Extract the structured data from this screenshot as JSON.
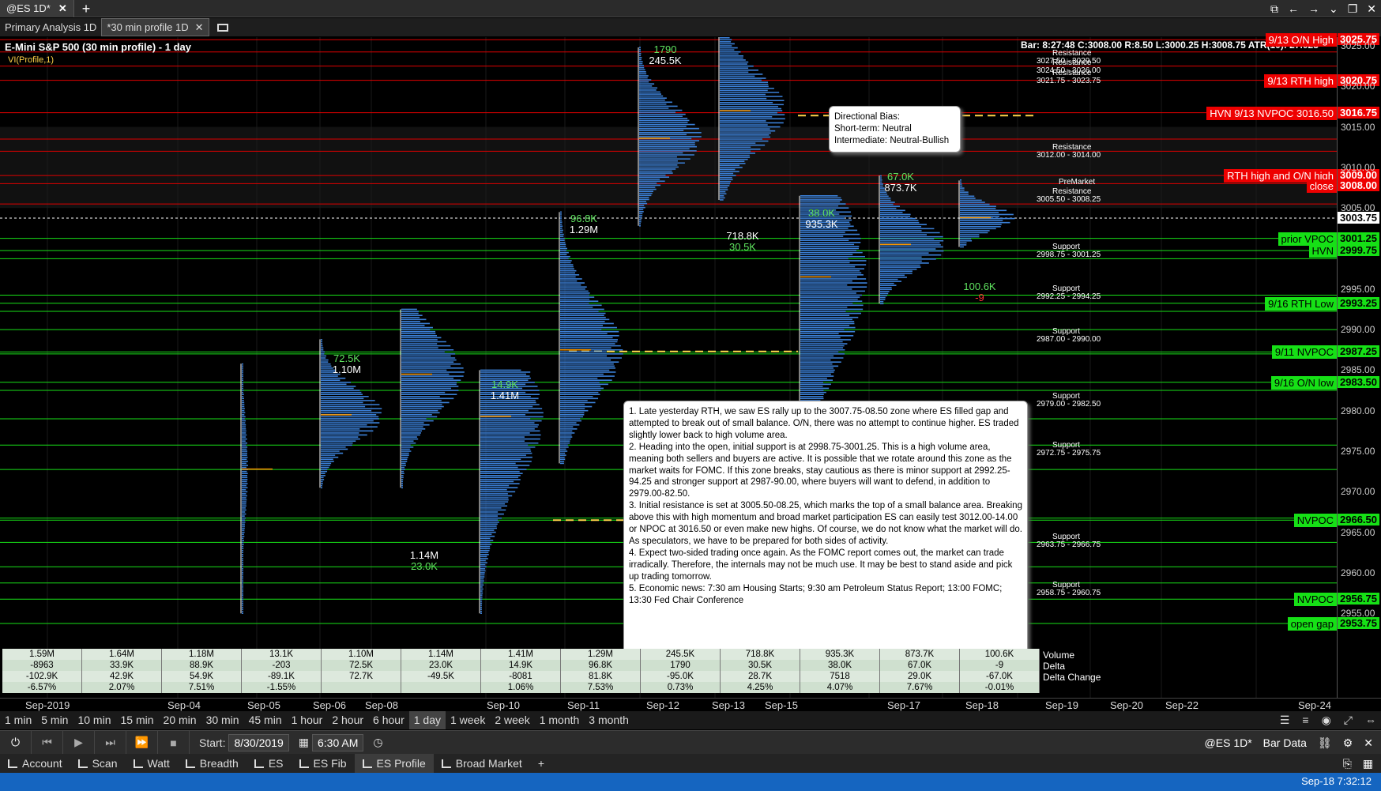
{
  "window": {
    "tabs": [
      {
        "label": "@ES 1D*"
      },
      {
        "label": "Primary Analysis 1D"
      },
      {
        "label": "*30 min profile 1D"
      }
    ]
  },
  "chart": {
    "title": "E-Mini S&P 500 (30 min profile) - 1 day",
    "study": "VI(Profile,1)",
    "bar_info": "Bar: 8:27:48 C:3008.00  R:8.50  L:3000.25  H:3008.75  ATR(10): 27.025",
    "last_price": "3003.75",
    "price_axis": [
      "3025.00",
      "3020.00",
      "3015.00",
      "3010.00",
      "3005.00",
      "2995.00",
      "2990.00",
      "2985.00",
      "2980.00",
      "2975.00",
      "2970.00",
      "2965.00",
      "2960.00",
      "2955.00"
    ],
    "right_labels": [
      {
        "text": "9/13 O/N High",
        "price": "3025.75",
        "color": "red"
      },
      {
        "text": "9/13 RTH high",
        "price": "3020.75",
        "color": "red"
      },
      {
        "text": "HVN 9/13 NVPOC 3016.50",
        "price": "3016.75",
        "color": "red"
      },
      {
        "text": "RTH high and O/N high",
        "price": "3009.00",
        "color": "red"
      },
      {
        "text": "close",
        "price": "3008.00",
        "color": "red"
      },
      {
        "text": "prior VPOC",
        "price": "3001.25",
        "color": "green"
      },
      {
        "text": "HVN",
        "price": "2999.75",
        "color": "green"
      },
      {
        "text": "9/16 RTH Low",
        "price": "2993.25",
        "color": "green"
      },
      {
        "text": "9/11 NVPOC",
        "price": "2987.25",
        "color": "green"
      },
      {
        "text": "9/16 O/N low",
        "price": "2983.50",
        "color": "green"
      },
      {
        "text": "NVPOC",
        "price": "2966.50",
        "color": "green"
      },
      {
        "text": "NVPOC",
        "price": "2956.75",
        "color": "green"
      },
      {
        "text": "open gap",
        "price": "2953.75",
        "color": "green"
      }
    ],
    "zones": [
      {
        "type": "Resistance",
        "range": "3027.50 - 3029.50"
      },
      {
        "type": "Resistance",
        "range": "3024.50 - 3026.00"
      },
      {
        "type": "Resistance",
        "range": "3021.75 - 3023.75"
      },
      {
        "type": "Resistance",
        "range": "3012.00 - 3014.00"
      },
      {
        "type": "PreMarket",
        "range": ""
      },
      {
        "type": "Resistance",
        "range": "3005.50 - 3008.25"
      },
      {
        "type": "Support",
        "range": "2998.75 - 3001.25"
      },
      {
        "type": "Support",
        "range": "2992.25 - 2994.25"
      },
      {
        "type": "Support",
        "range": "2987.00 - 2990.00"
      },
      {
        "type": "Support",
        "range": "2979.00 - 2982.50"
      },
      {
        "type": "Support",
        "range": "2972.75 - 2975.75"
      },
      {
        "type": "Support",
        "range": "2963.75 - 2966.75"
      },
      {
        "type": "Support",
        "range": "2958.75 - 2960.75"
      }
    ],
    "profiles": [
      {
        "delta": "72.5K",
        "volume": "1.10M"
      },
      {
        "delta": "1.14M",
        "volume": "23.0K"
      },
      {
        "delta": "14.9K",
        "volume": "1.41M"
      },
      {
        "delta": "96.8K",
        "volume": "1.29M"
      },
      {
        "delta": "1790",
        "volume": "245.5K"
      },
      {
        "delta": "718.8K",
        "volume": "30.5K"
      },
      {
        "delta": "38.0K",
        "volume": "935.3K"
      },
      {
        "delta": "67.0K",
        "volume": "873.7K"
      },
      {
        "delta": "100.6K",
        "volume": "-9"
      }
    ],
    "bias_note": {
      "title": "Directional Bias:",
      "short": "Short-term: Neutral",
      "intermediate": "Intermediate: Neutral-Bullish"
    },
    "plan_note": [
      "1. Late yesterday RTH, we saw ES rally up to the 3007.75-08.50 zone where ES filled gap and attempted to break out of small balance.  O/N, there was no attempt to continue higher. ES traded slightly lower back to high volume area.",
      "2. Heading into the open, initial support is at 2998.75-3001.25.  This is a high volume area, meaning both sellers and buyers are active.  It is possible that we rotate around this zone as the market waits for FOMC.  If this zone breaks, stay cautious as there is minor support at 2992.25-94.25 and stronger support at 2987-90.00, where buyers will want to defend, in addition to 2979.00-82.50.",
      "3. Initial resistance is set at 3005.50-08.25, which marks the top of a small balance area. Breaking above this with high momentum and broad market participation ES can easily test 3012.00-14.00 or NPOC at 3016.50 or even make new highs.  Of course, we do not know what the market will do. As speculators, we have to be prepared for both sides of activity.",
      "4.  Expect two-sided trading once again.  As the FOMC report comes out, the market can trade irradically.  Therefore, the internals may not be much use.  It may be best to stand aside and pick up trading tomorrow.",
      "5.  Economic news: 7:30 am Housing Starts;  9:30 am Petroleum Status Report; 13:00 FOMC; 13:30 Fed Chair Conference"
    ],
    "stats": {
      "row_labels": [
        "Volume",
        "Delta",
        "Delta Change",
        ""
      ],
      "rows": [
        [
          "1.59M",
          "1.64M",
          "1.18M",
          "13.1K",
          "1.10M",
          "1.14M",
          "1.41M",
          "1.29M",
          "245.5K",
          "718.8K",
          "935.3K",
          "873.7K",
          "100.6K"
        ],
        [
          "-8963",
          "33.9K",
          "88.9K",
          "-203",
          "72.5K",
          "23.0K",
          "14.9K",
          "96.8K",
          "1790",
          "30.5K",
          "38.0K",
          "67.0K",
          "-9"
        ],
        [
          "-102.9K",
          "42.9K",
          "54.9K",
          "-89.1K",
          "72.7K",
          "-49.5K",
          "-8081",
          "81.8K",
          "-95.0K",
          "28.7K",
          "7518",
          "29.0K",
          "-67.0K"
        ],
        [
          "-6.57%",
          "2.07%",
          "7.51%",
          "-1.55%",
          "",
          "",
          "1.06%",
          "7.53%",
          "0.73%",
          "4.25%",
          "4.07%",
          "7.67%",
          "-0.01%"
        ]
      ]
    },
    "dates": [
      "Sep-2019",
      "Sep-04",
      "Sep-05",
      "Sep-06",
      "Sep-08",
      "Sep-10",
      "Sep-11",
      "Sep-12",
      "Sep-13",
      "Sep-15",
      "Sep-17",
      "Sep-18",
      "Sep-19",
      "Sep-20",
      "Sep-22",
      "Sep-24"
    ]
  },
  "intervals": [
    "1 min",
    "5 min",
    "10 min",
    "15 min",
    "20 min",
    "30 min",
    "45 min",
    "1 hour",
    "2 hour",
    "6 hour",
    "1 day",
    "1 week",
    "2 week",
    "1 month",
    "3 month"
  ],
  "active_interval": "1 day",
  "controls": {
    "start_label": "Start:",
    "start_date": "8/30/2019",
    "start_time": "6:30 AM",
    "symbol": "@ES 1D*",
    "bar_data": "Bar Data"
  },
  "workspace_tabs": [
    "Account",
    "Scan",
    "Watt",
    "Breadth",
    "ES",
    "ES Fib",
    "ES Profile",
    "Broad Market"
  ],
  "active_workspace": "ES Profile",
  "status": {
    "clock": "Sep-18 7:32:12"
  },
  "colors": {
    "resistance": "#e00000",
    "support": "#18e018",
    "profile": "#3b7fd6",
    "poc": "#ffd34a"
  }
}
